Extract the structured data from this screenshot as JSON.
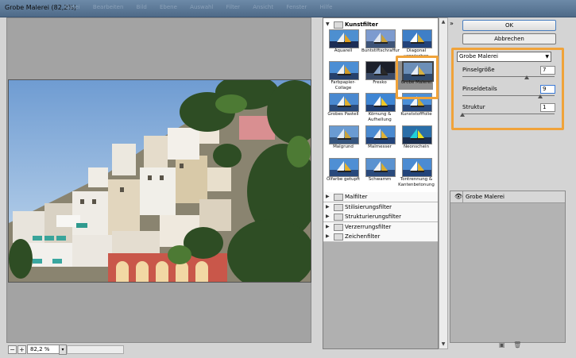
{
  "window": {
    "title": "Grobe Malerei (82,2%)",
    "menus": [
      "Datei",
      "Bearbeiten",
      "Bild",
      "Ebene",
      "Auswahl",
      "Filter",
      "Ansicht",
      "Fenster",
      "Hilfe"
    ]
  },
  "status": {
    "zoom_minus": "−",
    "zoom_plus": "+",
    "zoom_value": "82,2 %",
    "zoom_dropdown": "▾"
  },
  "gallery": {
    "open_folder": "Kunstfilter",
    "open_folder_icon": "triangle-down-icon",
    "thumbs": [
      {
        "label": "Aquarell"
      },
      {
        "label": "Buntstiftschraffur"
      },
      {
        "label": "Diagonal verwischen"
      },
      {
        "label": "Farbpapier-Collage"
      },
      {
        "label": "Fresko"
      },
      {
        "label": "Grobe Malerei"
      },
      {
        "label": "Grobes Pastell"
      },
      {
        "label": "Körnung & Aufhellung"
      },
      {
        "label": "Kunststofffolie"
      },
      {
        "label": "Malgrund"
      },
      {
        "label": "Malmesser"
      },
      {
        "label": "Neonschein"
      },
      {
        "label": "Ölfarbe getupft"
      },
      {
        "label": "Schwamm"
      },
      {
        "label": "Tontrennung & Kantenbetonung"
      }
    ],
    "selected_index": 5,
    "folders": [
      "Malfilter",
      "Stilisierungsfilter",
      "Strukturierungsfilter",
      "Verzerrungsfilter",
      "Zeichenfilter"
    ]
  },
  "actions": {
    "ok_label": "OK",
    "cancel_label": "Abbrechen",
    "collapse_icon": "double-chevron-up-icon"
  },
  "settings": {
    "filter_selected": "Grobe Malerei",
    "params": [
      {
        "label": "Pinselgröße",
        "value": "7",
        "slider": 0.72
      },
      {
        "label": "Pinseldetails",
        "value": "9",
        "slider": 0.87
      },
      {
        "label": "Struktur",
        "value": "1",
        "slider": 0.0
      }
    ]
  },
  "layers": {
    "items": [
      {
        "name": "Grobe Malerei",
        "visible": true
      }
    ],
    "icons": [
      "new-effect-layer-icon",
      "delete-effect-layer-icon"
    ]
  },
  "colors": {
    "highlight": "#f0a33a",
    "titlebar": "#5a7898"
  }
}
